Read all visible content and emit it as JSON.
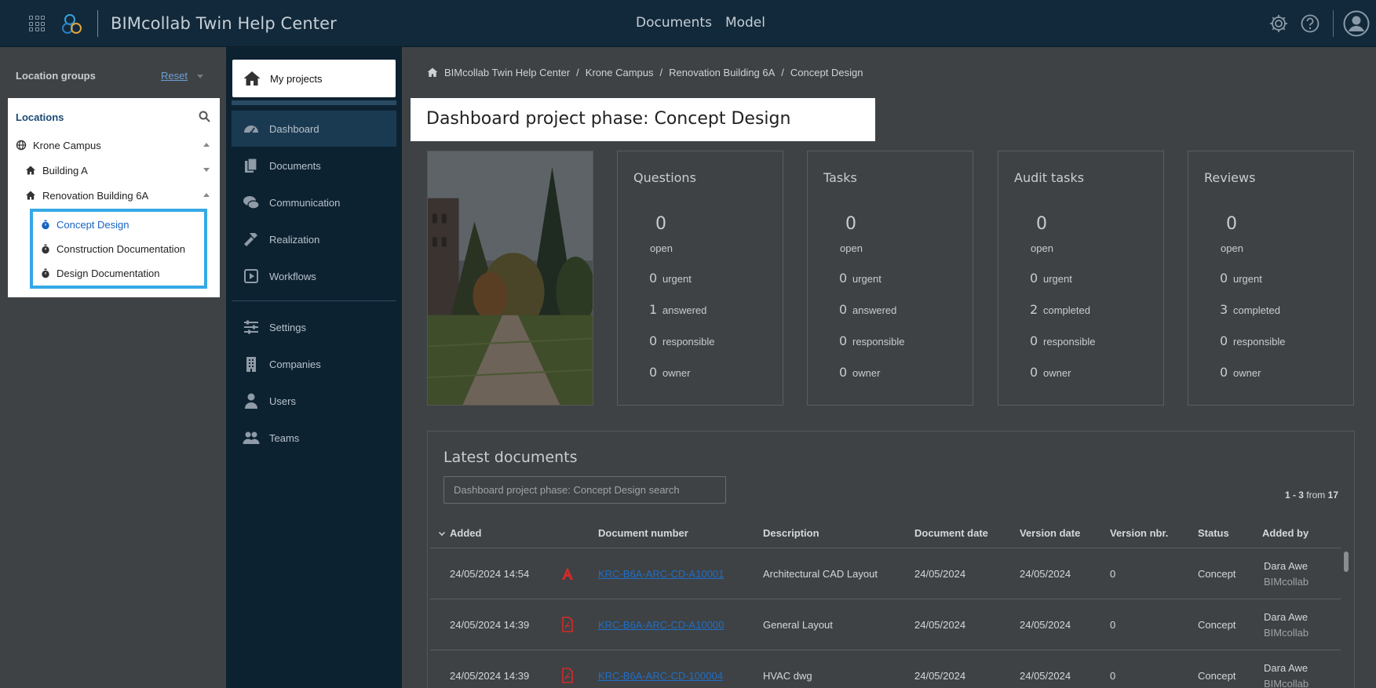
{
  "topbar": {
    "app_title": "BIMcollab Twin Help Center",
    "nav": [
      "Documents",
      "Model"
    ]
  },
  "location_panel": {
    "groups_label": "Location groups",
    "reset_label": "Reset",
    "header": "Locations",
    "tree": [
      {
        "label": "Krone Campus",
        "level": 0,
        "icon": "globe-icon",
        "caret": "up"
      },
      {
        "label": "Building A",
        "level": 1,
        "icon": "home-icon",
        "caret": "down"
      },
      {
        "label": "Renovation Building 6A",
        "level": 1,
        "icon": "home-icon",
        "caret": "up"
      }
    ],
    "phases": [
      {
        "label": "Concept Design",
        "active": true
      },
      {
        "label": "Construction Documentation",
        "active": false
      },
      {
        "label": "Design Documentation",
        "active": false
      }
    ]
  },
  "sidenav": {
    "my_projects": "My projects",
    "items": [
      {
        "label": "Dashboard",
        "icon": "gauge-icon",
        "active": true
      },
      {
        "label": "Documents",
        "icon": "documents-icon",
        "active": false
      },
      {
        "label": "Communication",
        "icon": "chat-icon",
        "active": false
      },
      {
        "label": "Realization",
        "icon": "hammer-icon",
        "active": false
      },
      {
        "label": "Workflows",
        "icon": "play-square-icon",
        "active": false
      }
    ],
    "items2": [
      {
        "label": "Settings",
        "icon": "sliders-icon"
      },
      {
        "label": "Companies",
        "icon": "building-icon"
      },
      {
        "label": "Users",
        "icon": "user-icon"
      },
      {
        "label": "Teams",
        "icon": "users-icon"
      }
    ]
  },
  "breadcrumb": [
    "BIMcollab Twin Help Center",
    "Krone Campus",
    "Renovation Building 6A",
    "Concept Design"
  ],
  "page_title": "Dashboard project phase: Concept Design",
  "stat_cards": [
    {
      "title": "Questions",
      "open": "0",
      "open_label": "open",
      "rows": [
        {
          "n": "0",
          "l": "urgent"
        },
        {
          "n": "1",
          "l": "answered"
        },
        {
          "n": "0",
          "l": "responsible"
        },
        {
          "n": "0",
          "l": "owner"
        }
      ]
    },
    {
      "title": "Tasks",
      "open": "0",
      "open_label": "open",
      "rows": [
        {
          "n": "0",
          "l": "urgent"
        },
        {
          "n": "0",
          "l": "answered"
        },
        {
          "n": "0",
          "l": "responsible"
        },
        {
          "n": "0",
          "l": "owner"
        }
      ]
    },
    {
      "title": "Audit tasks",
      "open": "0",
      "open_label": "open",
      "rows": [
        {
          "n": "0",
          "l": "urgent"
        },
        {
          "n": "2",
          "l": "completed"
        },
        {
          "n": "0",
          "l": "responsible"
        },
        {
          "n": "0",
          "l": "owner"
        }
      ]
    },
    {
      "title": "Reviews",
      "open": "0",
      "open_label": "open",
      "rows": [
        {
          "n": "0",
          "l": "urgent"
        },
        {
          "n": "3",
          "l": "completed"
        },
        {
          "n": "0",
          "l": "responsible"
        },
        {
          "n": "0",
          "l": "owner"
        }
      ]
    }
  ],
  "documents": {
    "title": "Latest documents",
    "search_placeholder": "Dashboard project phase: Concept Design search",
    "count_range": "1 - 3",
    "count_from": "from",
    "count_total": "17",
    "columns": [
      "Added",
      "Document number",
      "Description",
      "Document date",
      "Version date",
      "Version nbr.",
      "Status",
      "Added by"
    ],
    "rows": [
      {
        "added": "24/05/2024 14:54",
        "file_icon": "autocad-icon",
        "number": "KRC-B6A-ARC-CD-A10001",
        "description": "Architectural CAD Layout",
        "doc_date": "24/05/2024",
        "version_date": "24/05/2024",
        "version": "0",
        "status": "Concept",
        "added_by": "Dara Awe",
        "org": "BIMcollab"
      },
      {
        "added": "24/05/2024 14:39",
        "file_icon": "pdf-icon",
        "number": "KRC-B6A-ARC-CD-A10000",
        "description": "General Layout",
        "doc_date": "24/05/2024",
        "version_date": "24/05/2024",
        "version": "0",
        "status": "Concept",
        "added_by": "Dara Awe",
        "org": "BIMcollab"
      },
      {
        "added": "24/05/2024 14:39",
        "file_icon": "pdf-icon",
        "number": "KRC-B6A-ARC-CD-100004",
        "description": "HVAC dwg",
        "doc_date": "24/05/2024",
        "version_date": "24/05/2024",
        "version": "0",
        "status": "Concept",
        "added_by": "Dara Awe",
        "org": "BIMcollab"
      }
    ]
  },
  "colors": {
    "topbar": "#11293a",
    "sidenav": "#0d2231",
    "highlight": "#36a8e6",
    "link": "#1f6ec7",
    "overlay": "#3f4244"
  }
}
